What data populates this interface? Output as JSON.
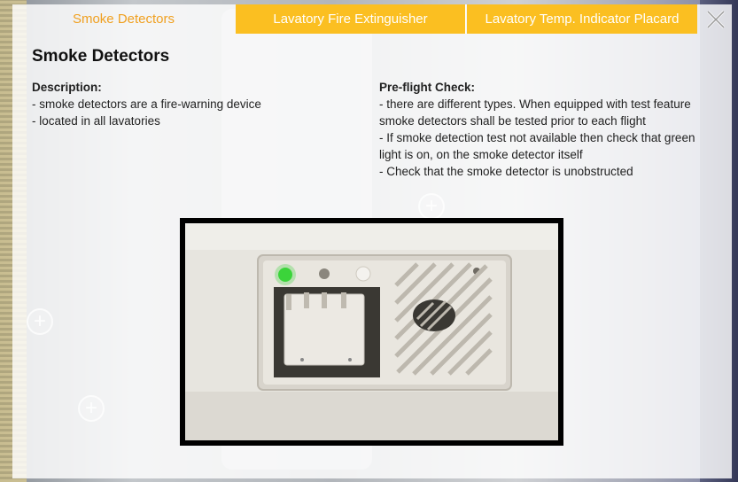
{
  "tabs": [
    {
      "label": "Smoke Detectors",
      "active": true
    },
    {
      "label": "Lavatory Fire Extinguisher",
      "active": false
    },
    {
      "label": "Lavatory Temp. Indicator Placard",
      "active": false
    }
  ],
  "close_icon": "close-icon",
  "content": {
    "title": "Smoke Detectors",
    "description": {
      "heading": "Description:",
      "lines": [
        "- smoke detectors are a fire-warning device",
        "- located in all lavatories"
      ]
    },
    "preflight": {
      "heading": "Pre-flight Check:",
      "lines": [
        "- there are different types. When equipped with test feature smoke detectors shall be tested prior to each flight",
        "- If smoke detection test not available then check that green light is on, on the smoke detector itself",
        "- Check that the smoke detector is unobstructed"
      ]
    }
  },
  "colors": {
    "tab_active_text": "#f0a020",
    "tab_bg": "#fbbf21",
    "indicator_light": "#3bd43a"
  },
  "hotspot_icon": "plus-icon"
}
